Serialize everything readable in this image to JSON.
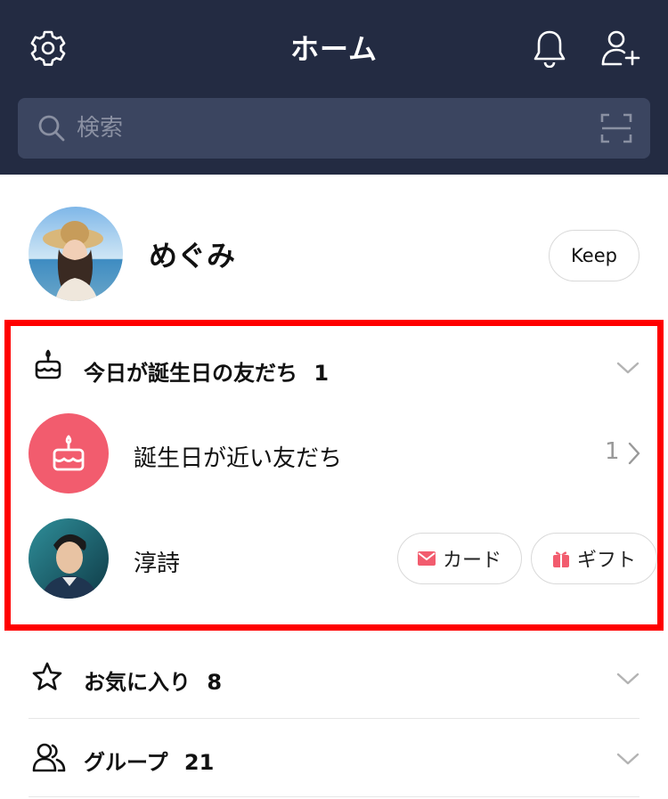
{
  "header": {
    "title": "ホーム",
    "settings_icon": "gear-icon",
    "bell_icon": "bell-icon",
    "add_friend_icon": "add-friend-icon"
  },
  "search": {
    "placeholder": "検索",
    "value": "",
    "scan_icon": "qr-scan-icon"
  },
  "profile": {
    "name": "めぐみ",
    "keep_label": "Keep"
  },
  "birthday_section": {
    "title": "今日が誕生日の友だち",
    "count": "1",
    "upcoming": {
      "label": "誕生日が近い友だち",
      "count": "1"
    },
    "friend": {
      "name": "淳詩",
      "card_label": "カード",
      "gift_label": "ギフト"
    }
  },
  "favorites": {
    "title": "お気に入り",
    "count": "8"
  },
  "groups": {
    "title": "グループ",
    "count": "21"
  },
  "colors": {
    "header_bg": "#232b42",
    "search_bg": "#3b4560",
    "highlight": "#ff0000",
    "birthday_accent": "#f25c6e"
  }
}
